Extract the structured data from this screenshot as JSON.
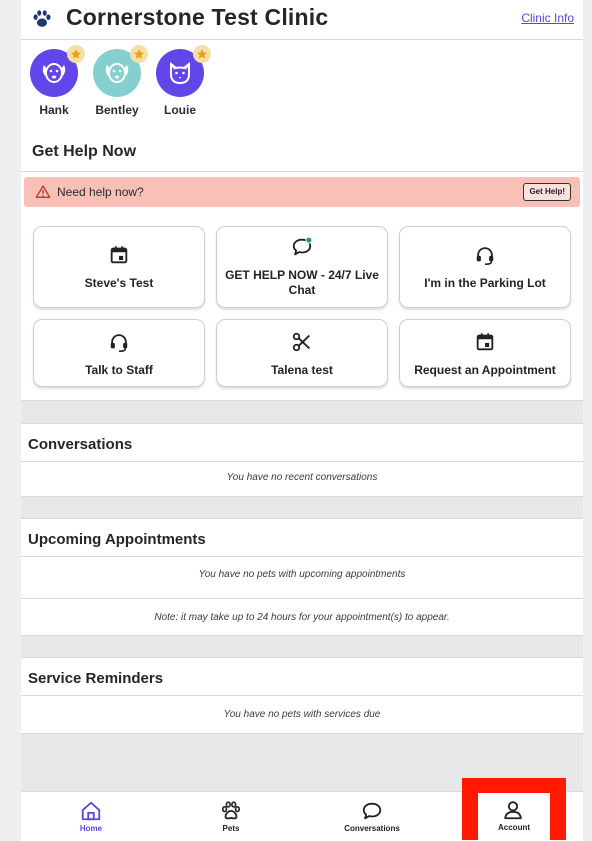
{
  "header": {
    "clinic_name": "Cornerstone Test Clinic",
    "clinic_info_link": "Clinic Info"
  },
  "pets": [
    {
      "name": "Hank",
      "avatar_color": "#6246ea",
      "icon": "dog-face-icon"
    },
    {
      "name": "Bentley",
      "avatar_color": "#86cfcf",
      "icon": "dog-face-icon"
    },
    {
      "name": "Louie",
      "avatar_color": "#6246ea",
      "icon": "cat-face-icon"
    }
  ],
  "get_help": {
    "title": "Get Help Now",
    "alert_text": "Need help now?",
    "alert_button": "Get Help!",
    "tiles": [
      {
        "label": "Steve's Test",
        "icon": "calendar-icon"
      },
      {
        "label": "GET HELP NOW - 24/7 Live Chat",
        "icon": "chat-bubble-icon"
      },
      {
        "label": "I'm in the Parking Lot",
        "icon": "headset-icon"
      },
      {
        "label": "Talk to Staff",
        "icon": "headset-icon"
      },
      {
        "label": "Talena test",
        "icon": "scissors-icon"
      },
      {
        "label": "Request an Appointment",
        "icon": "calendar-icon"
      }
    ]
  },
  "conversations": {
    "title": "Conversations",
    "empty": "You have no recent conversations"
  },
  "appointments": {
    "title": "Upcoming Appointments",
    "empty": "You have no pets with upcoming appointments",
    "note": "Note: it may take up to 24 hours for your appointment(s) to appear."
  },
  "reminders": {
    "title": "Service Reminders",
    "empty": "You have no pets with services due"
  },
  "bottom_nav": {
    "home": "Home",
    "pets": "Pets",
    "conversations": "Conversations",
    "account": "Account"
  },
  "colors": {
    "accent": "#5b45e0",
    "alert_bg": "#f9c0b8",
    "highlight": "#ff1a00",
    "online_dot": "#1f9d55"
  }
}
